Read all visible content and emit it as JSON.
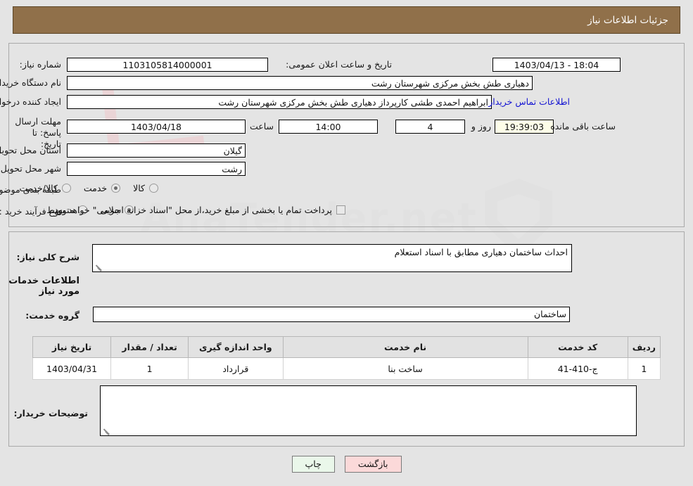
{
  "header": {
    "title": "جزئیات اطلاعات نیاز"
  },
  "form": {
    "need_number_label": "شماره نیاز:",
    "need_number_value": "1103105814000001",
    "announce_label": "تاریخ و ساعت اعلان عمومی:",
    "announce_value": "18:04 - 1403/04/13",
    "buyer_org_label": "نام دستگاه خریدار:",
    "buyer_org_value": "دهیاری طش بخش مرکزی شهرستان رشت",
    "requester_label": "ایجاد کننده درخواست:",
    "requester_value": "ابراهیم احمدی طشی کارپرداز دهیاری طش بخش مرکزی شهرستان رشت",
    "contact_link": "اطلاعات تماس خریدار",
    "deadline_label": "مهلت ارسال پاسخ: تا تاریخ:",
    "deadline_date": "1403/04/18",
    "hour_label": "ساعت",
    "deadline_time": "14:00",
    "days_remaining": "4",
    "days_and_label": "روز و",
    "countdown": "19:39:03",
    "remaining_suffix": "ساعت باقی مانده",
    "province_label": "استان محل تحویل:",
    "province_value": "گیلان",
    "city_label": "شهر محل تحویل:",
    "city_value": "رشت",
    "category_label": "طبقه بندی موضوعی:",
    "category_options": [
      "کالا",
      "خدمت",
      "کالا/خدمت"
    ],
    "category_selected": "خدمت",
    "process_label": "نوع فرآیند خرید :",
    "process_options": [
      "جزیی",
      "متوسط"
    ],
    "process_selected": "جزیی",
    "treasury_note": "پرداخت تمام یا بخشی از مبلغ خرید،از محل \"اسناد خزانه اسلامی\" خواهد بود.",
    "treasury_checked": false
  },
  "description": {
    "label": "شرح کلی نیاز:",
    "value": "احداث ساختمان دهیاری مطابق با اسناد استعلام"
  },
  "services_section": {
    "title": "اطلاعات خدمات مورد نیاز",
    "group_label": "گروه خدمت:",
    "group_value": "ساختمان"
  },
  "table": {
    "headers": [
      "ردیف",
      "کد خدمت",
      "نام خدمت",
      "واحد اندازه گیری",
      "تعداد / مقدار",
      "تاریخ نیاز"
    ],
    "rows": [
      {
        "row": "1",
        "code": "ج-410-41",
        "name": "ساخت بنا",
        "unit": "قرارداد",
        "qty": "1",
        "date": "1403/04/31"
      }
    ]
  },
  "buyer_notes": {
    "label": "توضیحات خریدار:",
    "value": ""
  },
  "buttons": {
    "print": "چاپ",
    "back": "بازگشت"
  },
  "watermark": {
    "text": "AnaTender.net"
  },
  "colors": {
    "header_bg": "#90704a",
    "link": "#1414d2",
    "code": "#7a6a22",
    "print_btn": "#eaf7ea",
    "back_btn": "#fbd9d9"
  }
}
